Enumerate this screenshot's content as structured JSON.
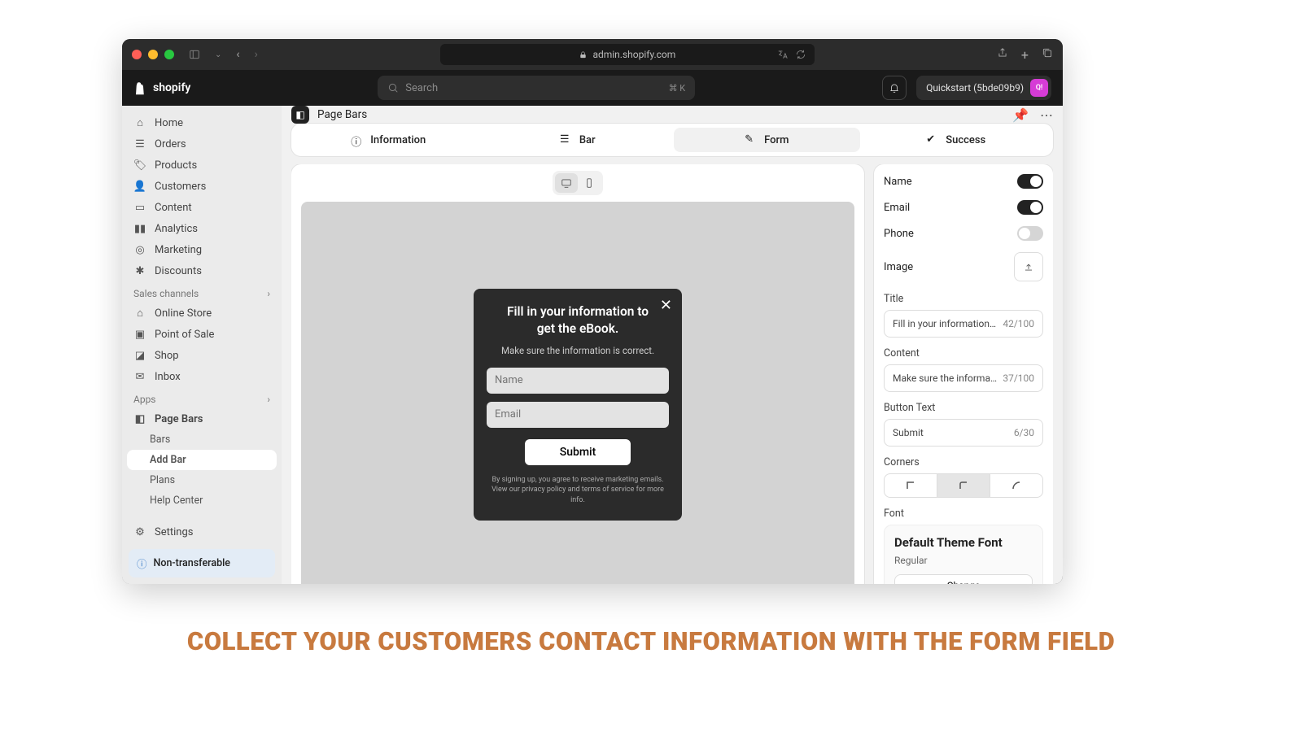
{
  "browser": {
    "url": "admin.shopify.com"
  },
  "shopify": {
    "brand": "shopify",
    "search_placeholder": "Search",
    "search_shortcut": "⌘ K",
    "store_name": "Quickstart (5bde09b9)",
    "avatar": "Q!"
  },
  "sidebar": {
    "items": [
      "Home",
      "Orders",
      "Products",
      "Customers",
      "Content",
      "Analytics",
      "Marketing",
      "Discounts"
    ],
    "section_channels": "Sales channels",
    "channels": [
      "Online Store",
      "Point of Sale",
      "Shop",
      "Inbox"
    ],
    "section_apps": "Apps",
    "app_name": "Page Bars",
    "app_sub": [
      "Bars",
      "Add Bar",
      "Plans",
      "Help Center"
    ],
    "settings": "Settings",
    "banner": "Non-transferable"
  },
  "page": {
    "title": "Page Bars"
  },
  "tabs": [
    "Information",
    "Bar",
    "Form",
    "Success"
  ],
  "modal": {
    "title": "Fill in your information to get the eBook.",
    "subtitle": "Make sure the information is correct.",
    "name_ph": "Name",
    "email_ph": "Email",
    "button": "Submit",
    "fine": "By signing up, you agree to receive marketing emails. View our privacy policy and terms of service for more info."
  },
  "panel": {
    "name": "Name",
    "email": "Email",
    "phone": "Phone",
    "image": "Image",
    "title_lbl": "Title",
    "title_val": "Fill in your information to g",
    "title_count": "42/100",
    "content_lbl": "Content",
    "content_val": "Make sure the information",
    "content_count": "37/100",
    "button_lbl": "Button Text",
    "button_val": "Submit",
    "button_count": "6/30",
    "corners_lbl": "Corners",
    "font_lbl": "Font",
    "font_name": "Default Theme Font",
    "font_weight": "Regular",
    "change": "Change"
  },
  "headline": "COLLECT YOUR CUSTOMERS CONTACT INFORMATION WITH THE FORM FIELD"
}
